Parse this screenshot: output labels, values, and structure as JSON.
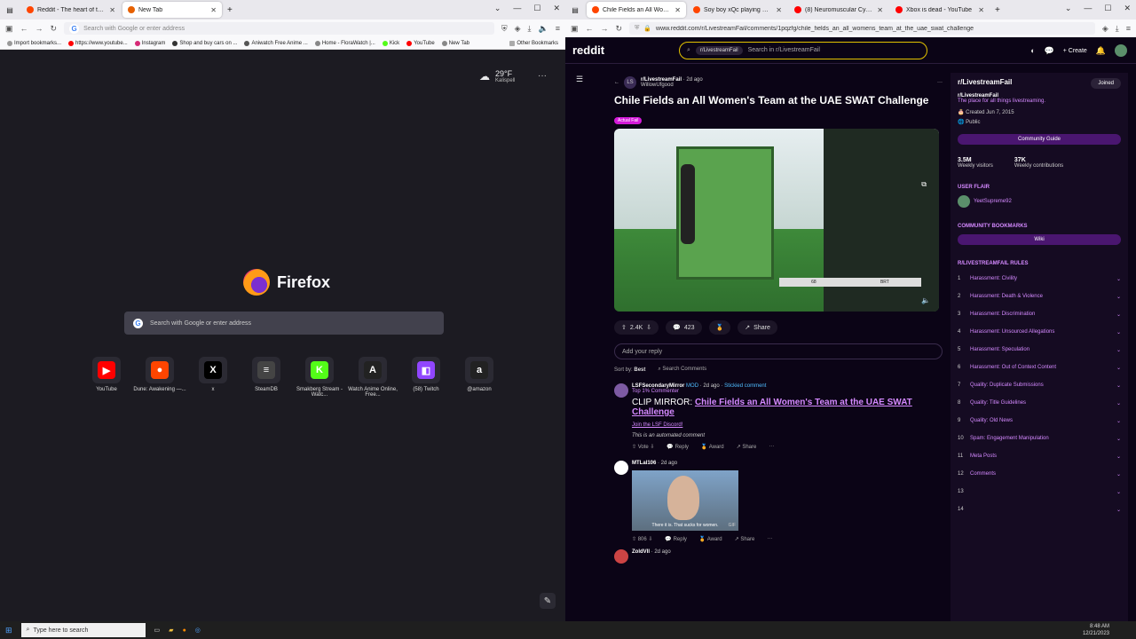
{
  "left": {
    "tabs": [
      {
        "title": "Reddit - The heart of the intern",
        "color": "#ff4500"
      },
      {
        "title": "New Tab",
        "color": "#e66000"
      }
    ],
    "url_placeholder": "Search with Google or enter address",
    "bookmarks": [
      "Import bookmarks...",
      "https://www.youtube...",
      "Instagram",
      "Shop and buy cars on ...",
      "Aniwatch Free Anime ...",
      "Home - FloraWatch |...",
      "Kick",
      "YouTube",
      "New Tab",
      "Other Bookmarks"
    ],
    "weather": {
      "temp": "29°F",
      "city": "Kalispell"
    },
    "brand": "Firefox",
    "search_placeholder": "Search with Google or enter address",
    "tiles": [
      {
        "label": "YouTube",
        "glyph": "▶",
        "color": "#ff0000"
      },
      {
        "label": "Dune: Awakening —...",
        "glyph": "●",
        "color": "#ff4500"
      },
      {
        "label": "x",
        "glyph": "X",
        "color": "#000000"
      },
      {
        "label": "SteamDB",
        "glyph": "≡",
        "color": "#444444"
      },
      {
        "label": "Smakberg Stream - Watc...",
        "glyph": "K",
        "color": "#53fc18"
      },
      {
        "label": "Watch Anime Online, Free...",
        "glyph": "A",
        "color": "#222222"
      },
      {
        "label": "(58) Twitch",
        "glyph": "◧",
        "color": "#9146ff"
      },
      {
        "label": "@amazon",
        "glyph": "a",
        "color": "#222222"
      }
    ]
  },
  "right": {
    "tabs": [
      {
        "title": "Chile Fields an All Women's T",
        "color": "#ff4500"
      },
      {
        "title": "Soy boy xQc playing Minecraft",
        "color": "#ff4500"
      },
      {
        "title": "(8) Neuromuscular Cyborg Arm",
        "color": "#ff0000"
      },
      {
        "title": "Xbox is dead - YouTube",
        "color": "#ff0000"
      }
    ],
    "url": "www.reddit.com/r/LivestreamFail/comments/1pqzfg/chile_fields_an_all_womens_team_at_the_uae_swat_challenge",
    "logo": "reddit",
    "search_chip": "r/LivestreamFail",
    "search_placeholder": "Search in r/LivestreamFail",
    "create": "Create",
    "post": {
      "sub": "r/LivestreamFail",
      "age": "· 2d ago",
      "author": "WillowUfgood",
      "title": "Chile Fields an All Women's Team at the UAE SWAT Challenge",
      "flair": "Actual Fail",
      "score_num": "68",
      "score_team": "BRT",
      "votes": "2.4K",
      "comments": "423",
      "share": "Share",
      "reply": "Add your reply",
      "sort_label": "Sort by:",
      "sort_value": "Best",
      "search_comments": "Search Comments"
    },
    "comments": [
      {
        "author": "LSFSecondaryMirror",
        "mod": "MOD",
        "age": "· 2d ago",
        "sticky": "Stickied comment",
        "badge": "Top 1% Commenter",
        "prefix": "CLIP MIRROR:",
        "link": "Chile Fields an All Women's Team at the UAE SWAT Challenge",
        "discord": "Join the LSF Discord!",
        "note": "This is an automated comment",
        "vote": "Vote",
        "reply": "Reply",
        "award": "Award",
        "share": "Share"
      },
      {
        "author": "MTLal106",
        "age": "· 2d ago",
        "gif_caption": "There it is. That sucks for women.",
        "gif_tag": "GIF",
        "votes": "806",
        "reply": "Reply",
        "award": "Award",
        "share": "Share"
      },
      {
        "author": "ZoldVII",
        "age": "· 2d ago"
      }
    ],
    "side": {
      "name": "r/LivestreamFail",
      "joined": "Joined",
      "title": "r/LivestreamFail",
      "desc": "The place for all things livestreaming.",
      "created": "Created Jun 7, 2015",
      "visibility": "Public",
      "guide": "Community Guide",
      "visitors": "3.5M",
      "visitors_label": "Weekly visitors",
      "contrib": "37K",
      "contrib_label": "Weekly contributions",
      "user_flair_h": "USER FLAIR",
      "user": "YeetSupreme92",
      "bookmarks_h": "COMMUNITY BOOKMARKS",
      "wiki": "Wiki",
      "rules_h": "R/LIVESTREAMFAIL RULES",
      "rules": [
        "Harassment: Civility",
        "Harassment: Death & Violence",
        "Harassment: Discrimination",
        "Harassment: Unsourced Allegations",
        "Harassment: Speculation",
        "Harassment: Out of Context Content",
        "Quality: Duplicate Submissions",
        "Quality: Title Guidelines",
        "Quality: Old News",
        "Spam: Engagement Manipulation",
        "Meta Posts",
        "Comments",
        "",
        ""
      ]
    }
  },
  "taskbar": {
    "search": "Type here to search",
    "time": "8:48 AM",
    "date": "12/21/2023"
  }
}
